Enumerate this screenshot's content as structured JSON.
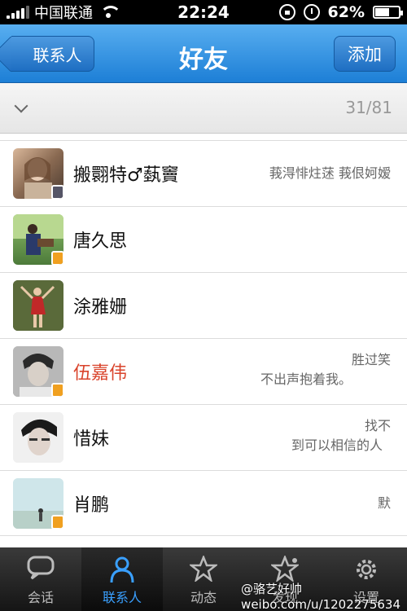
{
  "status_bar": {
    "carrier": "中国联通",
    "time": "22:24",
    "battery_percent": "62%",
    "battery_level": 0.62
  },
  "nav": {
    "back_label": "联系人",
    "title": "好友",
    "add_label": "添加"
  },
  "group": {
    "count": "31/81"
  },
  "contacts": [
    {
      "name": "搬翾特♂蓺竇",
      "signature_1": "莪淂悱炷蒁 莪佷妸嫒",
      "signature_2": "",
      "device": "phone",
      "name_color": "#111111"
    },
    {
      "name": "唐久思",
      "signature_1": "",
      "signature_2": "",
      "device": "qq",
      "name_color": "#111111"
    },
    {
      "name": "涂雅姗",
      "signature_1": "",
      "signature_2": "",
      "device": "",
      "name_color": "#111111"
    },
    {
      "name": "伍嘉伟",
      "signature_1": "胜过笑",
      "signature_2": "不出声抱着我。",
      "device": "qq",
      "name_color": "#d9432b"
    },
    {
      "name": "惜妹",
      "signature_1": "找不",
      "signature_2": "到可以相信的人",
      "device": "",
      "name_color": "#111111"
    },
    {
      "name": "肖鹏",
      "signature_1": "默",
      "signature_2": "",
      "device": "qq",
      "name_color": "#111111"
    }
  ],
  "tabs": [
    {
      "label": "会话",
      "icon": "chat-bubble-icon",
      "active": false
    },
    {
      "label": "联系人",
      "icon": "person-icon",
      "active": true
    },
    {
      "label": "动态",
      "icon": "star-icon",
      "active": false
    },
    {
      "label": "发现",
      "icon": "discover-star-icon",
      "active": false
    },
    {
      "label": "设置",
      "icon": "gear-icon",
      "active": false
    }
  ],
  "watermark": "weibo.com/u/1202275634",
  "watermark_name": "@骆艺好帅"
}
